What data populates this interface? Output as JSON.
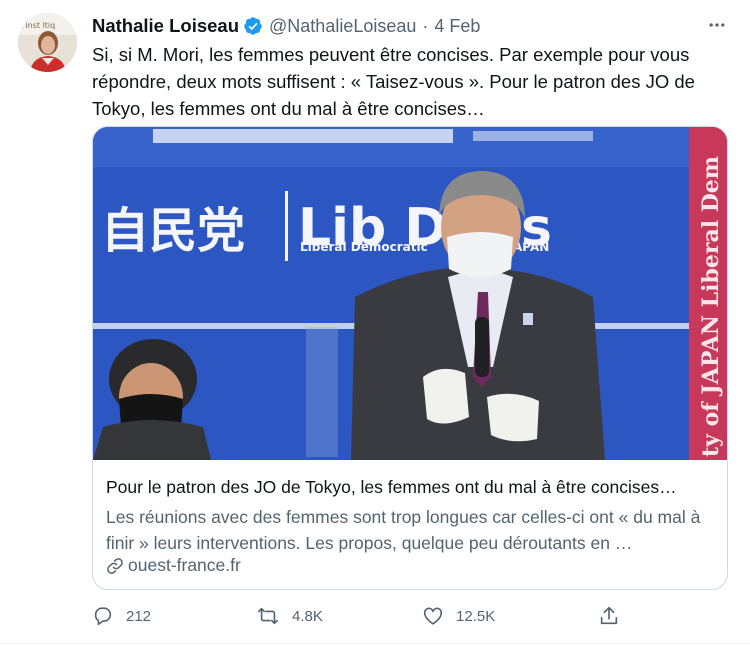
{
  "author": {
    "name": "Nathalie Loiseau",
    "handle": "@NathalieLoiseau",
    "separator": "·",
    "time": "4 Feb",
    "avatar_sign_text": "l'inst   ltiq"
  },
  "tweet": {
    "text": "Si, si M. Mori, les femmes peuvent être concises. Par exemple pour vous répondre, deux mots suffisent : « Taisez-vous ». Pour le patron des JO de Tokyo, les femmes ont du mal à être concises…"
  },
  "card": {
    "image": {
      "kanji": "自民党",
      "logo_text": "Lib D",
      "logo_text_end": "s",
      "logo_subtext": "Liberal Democratic",
      "logo_subtext_end": "APAN",
      "banner_text": "ty of JAPAN  Liberal Dem"
    },
    "title": "Pour le patron des JO de Tokyo, les femmes ont du mal à être concises…",
    "description": "Les réunions avec des femmes sont trop longues car celles-ci ont « du mal à finir » leurs interventions. Les propos, quelque peu déroutants en …",
    "domain": "ouest-france.fr"
  },
  "actions": {
    "reply_count": "212",
    "retweet_count": "4.8K",
    "like_count": "12.5K"
  },
  "colors": {
    "primary_text": "#0f1419",
    "secondary_text": "#536471",
    "verified_blue": "#1d9bf0",
    "border": "#cfd9de",
    "backdrop_blue": "#2c57c2",
    "banner_red": "#c8385a"
  },
  "icons": [
    "verified-badge-icon",
    "more-icon",
    "link-icon",
    "reply-icon",
    "retweet-icon",
    "like-icon",
    "share-icon"
  ]
}
